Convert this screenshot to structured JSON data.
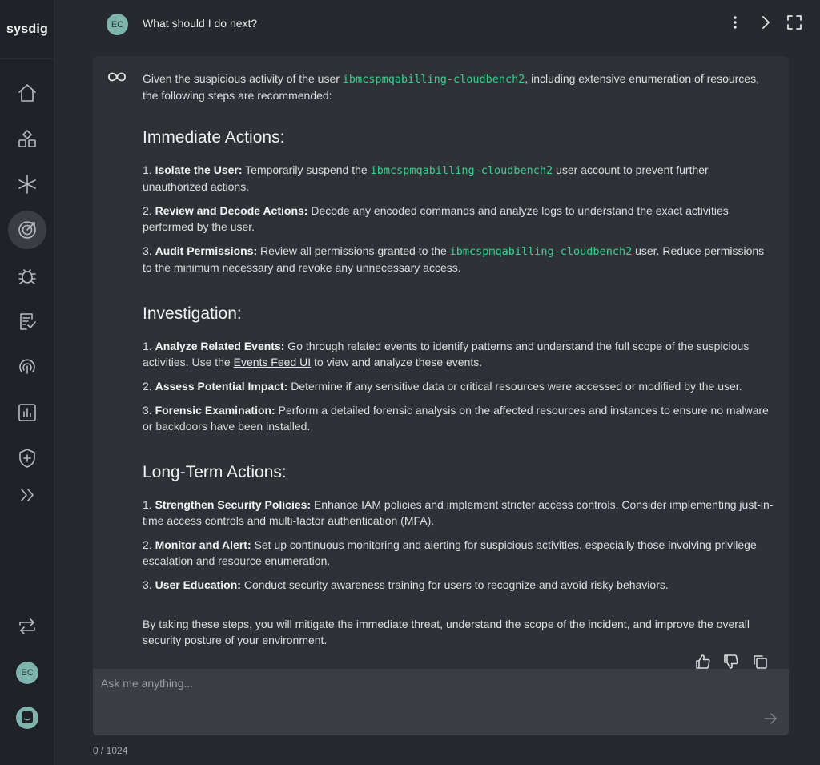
{
  "app": {
    "logo": "sysdig"
  },
  "header": {
    "user_initials": "EC",
    "question": "What should I do next?"
  },
  "sidebar": {
    "items": [
      {
        "name": "home"
      },
      {
        "name": "inventory"
      },
      {
        "name": "integrations"
      },
      {
        "name": "threats",
        "active": true
      },
      {
        "name": "vulnerabilities"
      },
      {
        "name": "compliance"
      },
      {
        "name": "identity"
      },
      {
        "name": "reports"
      },
      {
        "name": "policies"
      },
      {
        "name": "expand"
      }
    ],
    "user_initials": "EC"
  },
  "answer": {
    "intro_pre": "Given the suspicious activity of the user ",
    "user_code": "ibmcspmqabilling-cloudbench2",
    "intro_post": ", including extensive enumeration of resources, the following steps are recommended:",
    "s1_title": "Immediate Actions:",
    "s1_i1_num": "1. ",
    "s1_i1_label": "Isolate the User:",
    "s1_i1_pre": " Temporarily suspend the ",
    "s1_i1_code": "ibmcspmqabilling-cloudbench2",
    "s1_i1_post": " user account to prevent further unauthorized actions.",
    "s1_i2_num": "2. ",
    "s1_i2_label": "Review and Decode Actions:",
    "s1_i2_text": " Decode any encoded commands and analyze logs to understand the exact activities performed by the user.",
    "s1_i3_num": "3. ",
    "s1_i3_label": "Audit Permissions:",
    "s1_i3_pre": " Review all permissions granted to the ",
    "s1_i3_code": "ibmcspmqabilling-cloudbench2",
    "s1_i3_post": " user. Reduce permissions to the minimum necessary and revoke any unnecessary access.",
    "s2_title": "Investigation:",
    "s2_i1_num": "1. ",
    "s2_i1_label": "Analyze Related Events:",
    "s2_i1_pre": " Go through related events to identify patterns and understand the full scope of the suspicious activities. Use the ",
    "s2_i1_link": "Events Feed UI",
    "s2_i1_post": " to view and analyze these events.",
    "s2_i2_num": "2. ",
    "s2_i2_label": "Assess Potential Impact:",
    "s2_i2_text": " Determine if any sensitive data or critical resources were accessed or modified by the user.",
    "s2_i3_num": "3. ",
    "s2_i3_label": "Forensic Examination:",
    "s2_i3_text": " Perform a detailed forensic analysis on the affected resources and instances to ensure no malware or backdoors have been installed.",
    "s3_title": "Long-Term Actions:",
    "s3_i1_num": "1. ",
    "s3_i1_label": "Strengthen Security Policies:",
    "s3_i1_text": " Enhance IAM policies and implement stricter access controls. Consider implementing just-in-time access controls and multi-factor authentication (MFA).",
    "s3_i2_num": "2. ",
    "s3_i2_label": "Monitor and Alert:",
    "s3_i2_text": " Set up continuous monitoring and alerting for suspicious activities, especially those involving privilege escalation and resource enumeration.",
    "s3_i3_num": "3. ",
    "s3_i3_label": "User Education:",
    "s3_i3_text": " Conduct security awareness training for users to recognize and avoid risky behaviors.",
    "closing": "By taking these steps, you will mitigate the immediate threat, understand the scope of the incident, and improve the overall security posture of your environment."
  },
  "input": {
    "placeholder": "Ask me anything...",
    "value": "",
    "counter": "0 / 1024"
  },
  "colors": {
    "code": "#35d08e",
    "background": "#26292d",
    "panel": "#2e3135",
    "avatar": "#7fb3ad"
  }
}
